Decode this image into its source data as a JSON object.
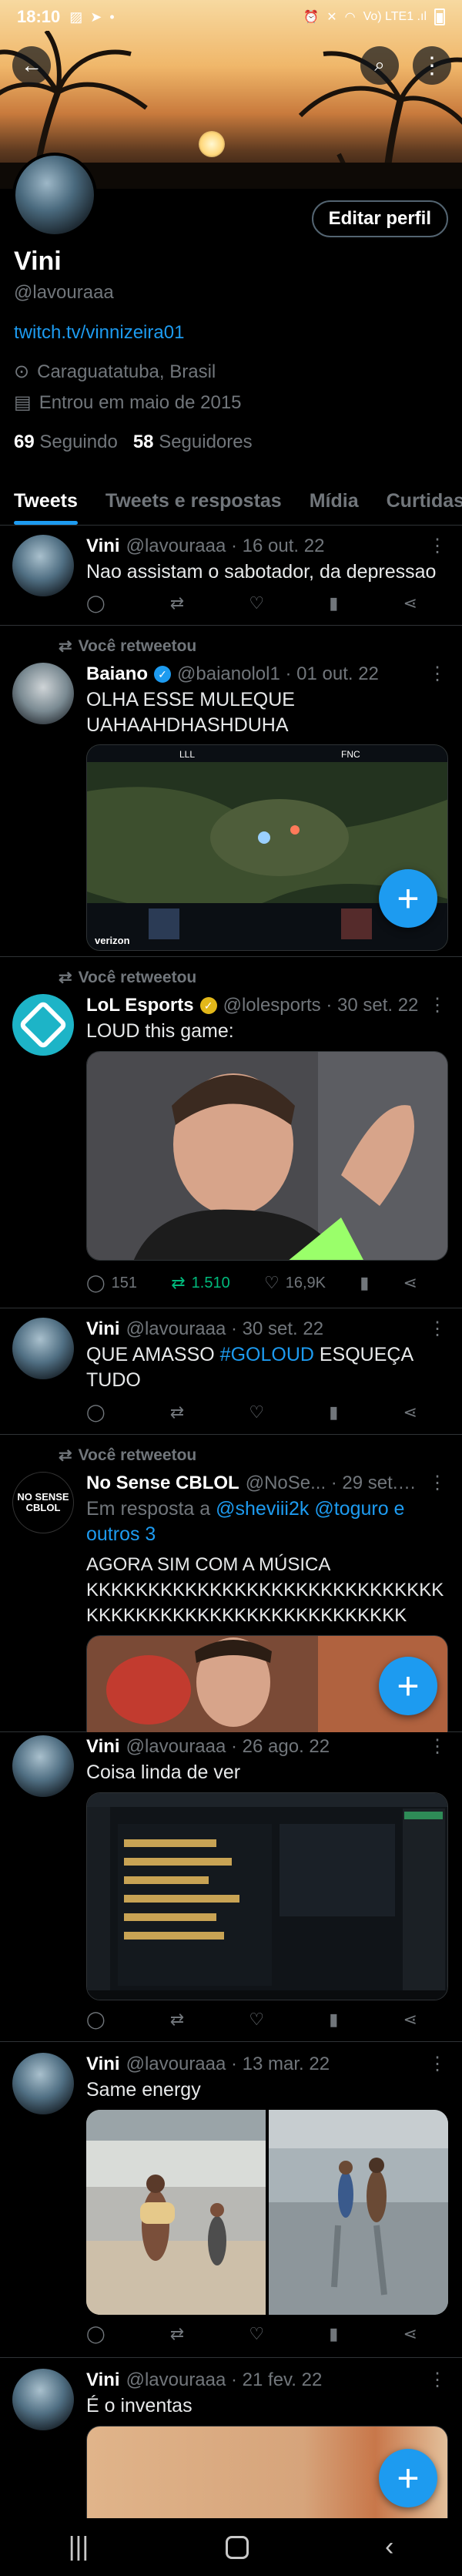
{
  "status_bar": {
    "time": "18:10",
    "network": "Vo) LTE1 .ıl"
  },
  "header": {
    "back_icon": "arrow-left-icon",
    "search_icon": "search-icon",
    "more_icon": "more-vertical-icon"
  },
  "profile": {
    "edit_label": "Editar perfil",
    "name": "Vini",
    "handle": "@lavouraaa",
    "link": "twitch.tv/vinnizeira01",
    "location": "Caraguatatuba, Brasil",
    "joined": "Entrou em maio de 2015",
    "following_count": "69",
    "following_label": "Seguindo",
    "followers_count": "58",
    "followers_label": "Seguidores"
  },
  "tabs": [
    "Tweets",
    "Tweets e respostas",
    "Mídia",
    "Curtidas"
  ],
  "tweets": [
    {
      "name": "Vini",
      "meta": "@lavouraaa · 16 out. 22",
      "text": "Nao assistam o sabotador, da depressao",
      "reply": "0",
      "retweet": "0",
      "like": "0"
    },
    {
      "retweet_label": "Você retweetou",
      "name": "Baiano",
      "meta": "@baianolol1 · 01 out. 22",
      "line1": "OLHA ESSE MULEQUE",
      "line2": "UAHAAHDHASHDUHA"
    },
    {
      "retweet_label": "Você retweetou",
      "name": "LoL Esports",
      "meta": "@lolesports · 30 set. 22",
      "text": "LOUD this game:",
      "reply": "151",
      "retweet": "1.510",
      "like": "16,9K"
    },
    {
      "name": "Vini",
      "meta": "@lavouraaa · 30 set. 22",
      "pre": "QUE AMASSO ",
      "hashtag": "#GOLOUD",
      "post": "  ESQUEÇA",
      "line2": "TUDO"
    },
    {
      "retweet_label": "Você retweetou",
      "name": "No Sense CBLOL",
      "meta": "@NoSe... · 29 set. 22",
      "reply_prefix": "Em resposta a ",
      "reply_mentions": "@sheviii2k @toguro e",
      "reply_more": "outros 3",
      "line1": "AGORA SIM COM A MÚSICA",
      "line2": "KKKKKKKKKKKKKKKKKKKKKKKKKKKKK",
      "line3": "KKKKKKKKKKKKKKKKKKKKKKKKKK"
    },
    {
      "name": "Vini",
      "meta": "@lavouraaa · 26 ago. 22",
      "text": "Coisa linda de ver"
    },
    {
      "name": "Vini",
      "meta": "@lavouraaa · 13 mar. 22",
      "text": "Same energy"
    },
    {
      "name": "Vini",
      "meta": "@lavouraaa · 21 fev. 22",
      "text": "É o inventas"
    }
  ],
  "nosense_logo": {
    "line1": "NO SENSE",
    "line2": "CBLOL"
  },
  "lol_screen": {
    "team_a": "LLL",
    "team_b": "FNC",
    "sponsor": "verizon"
  },
  "fab_label": "+",
  "nav": {
    "recents": "|||",
    "back": "‹"
  },
  "colors": {
    "accent": "#1d9bf0",
    "retweet_green": "#00ba7c",
    "muted": "#71767b",
    "border": "#2f3336"
  }
}
